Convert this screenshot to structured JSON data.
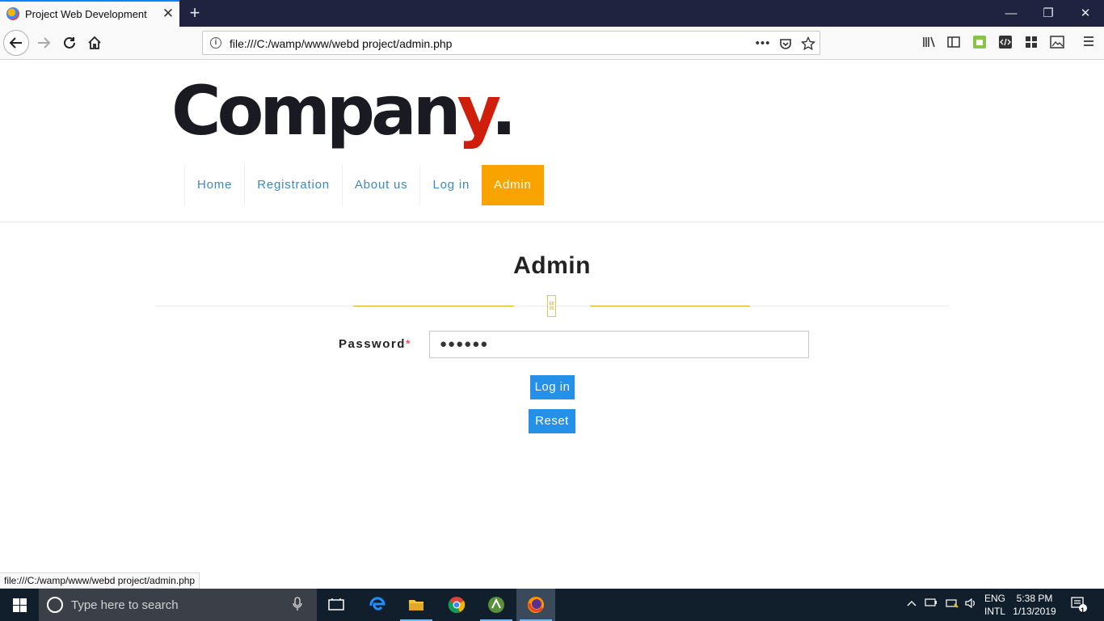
{
  "browser": {
    "tab_title": "Project Web Development",
    "tab_close": "✕",
    "new_tab": "+",
    "url": "file:///C:/wamp/www/webd project/admin.php",
    "minimize": "—",
    "restore": "❐",
    "close": "✕",
    "status_url": "file:///C:/wamp/www/webd project/admin.php"
  },
  "logo": {
    "text_main": "Compan",
    "text_accent": "y",
    "text_dot": "."
  },
  "menu": {
    "items": [
      {
        "label": "Home"
      },
      {
        "label": "Registration"
      },
      {
        "label": "About us"
      },
      {
        "label": "Log in"
      },
      {
        "label": "Admin",
        "active": true
      }
    ]
  },
  "admin": {
    "title": "Admin",
    "ornament_text": "E8 09",
    "password_label": "Password",
    "required_mark": "*",
    "password_value": "●●●●●●",
    "login_button": "Log in",
    "reset_button": "Reset"
  },
  "taskbar": {
    "search_placeholder": "Type here to search",
    "lang_top": "ENG",
    "lang_bottom": "INTL",
    "time": "5:38 PM",
    "date": "1/13/2019",
    "notification_count": "1"
  },
  "colors": {
    "accent_orange": "#f8a300",
    "link_blue": "#3b88c3",
    "button_blue": "#2590e8",
    "logo_red": "#cf1f0c",
    "titlebar": "#202340"
  }
}
